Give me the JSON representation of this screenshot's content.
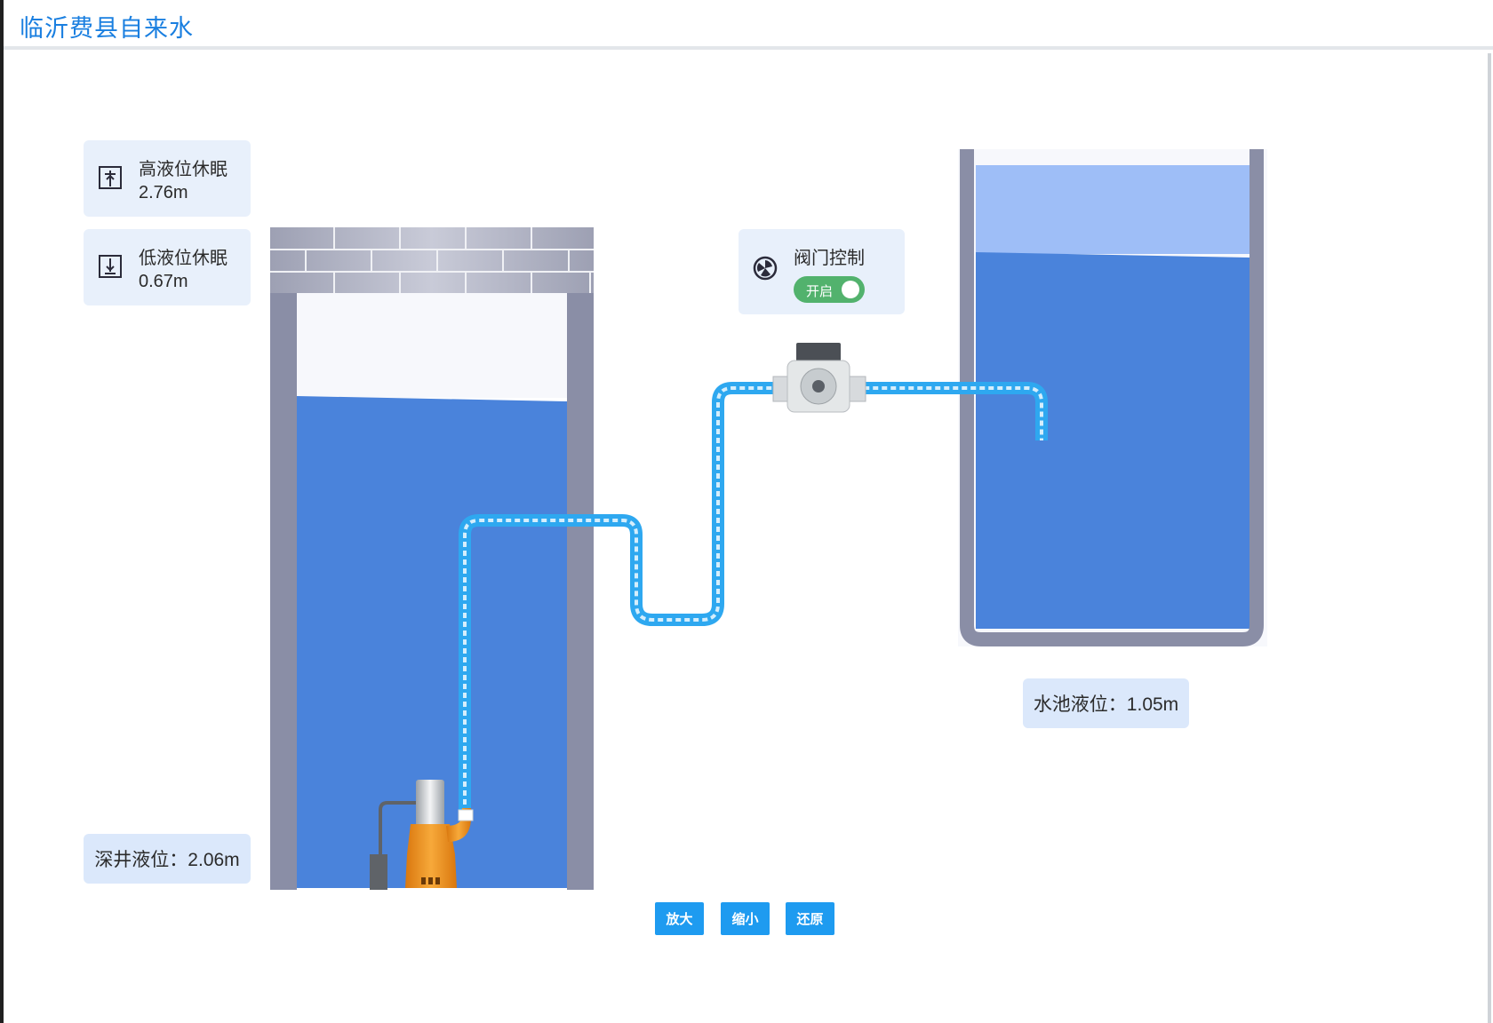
{
  "header": {
    "title": "临沂费县自来水"
  },
  "well_panel": {
    "high_sleep": {
      "title": "高液位休眠",
      "value": "2.76m",
      "icon": "high-level-icon"
    },
    "low_sleep": {
      "title": "低液位休眠",
      "value": "0.67m",
      "icon": "low-level-icon"
    },
    "deep_well_level": "深井液位：2.06m"
  },
  "valve": {
    "title": "阀门控制",
    "state_label": "开启",
    "icon": "valve-icon",
    "is_on": true
  },
  "pool": {
    "level_label": "水池液位：1.05m"
  },
  "controls": {
    "zoom_in": "放大",
    "zoom_out": "缩小",
    "reset": "还原"
  },
  "colors": {
    "title": "#1a7fe0",
    "water": "#4a83db",
    "water_light": "#9ebef7",
    "pipe": "#2ea8f0",
    "wall": "#8a8ea6",
    "card": "#e8f0fb",
    "toggle_on": "#52b26d",
    "button": "#1e9bf0",
    "pump": "#f0941e"
  }
}
